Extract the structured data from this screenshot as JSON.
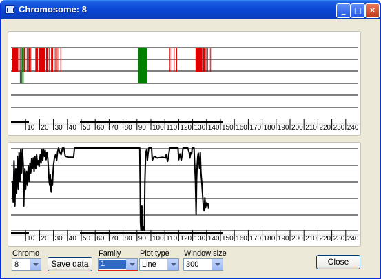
{
  "window": {
    "title": "Chromosome: 8"
  },
  "x_ticks": [
    "10",
    "20",
    "30",
    "40",
    "50",
    "60",
    "70",
    "80",
    "90",
    "100",
    "110",
    "120",
    "130",
    "140",
    "150",
    "160",
    "170",
    "180",
    "190",
    "200",
    "210",
    "220",
    "230",
    "240"
  ],
  "colors": {
    "family_a": "#e00000",
    "family_b": "#008000",
    "line": "#000000"
  },
  "top_plot": {
    "track1": [
      {
        "x": [
          0.0,
          4.2
        ],
        "c": "family_a"
      },
      {
        "x": [
          4.5,
          4.9
        ],
        "c": "family_a"
      },
      {
        "x": [
          5.3,
          5.8
        ],
        "c": "family_a"
      },
      {
        "x": [
          6.6,
          7.4
        ],
        "c": "family_b"
      },
      {
        "x": [
          7.6,
          8.2
        ],
        "c": "family_b"
      },
      {
        "x": [
          8.3,
          9.4
        ],
        "c": "family_a"
      },
      {
        "x": [
          10.3,
          10.8
        ],
        "c": "family_a"
      },
      {
        "x": [
          11.5,
          12.6
        ],
        "c": "family_a"
      },
      {
        "x": [
          13.0,
          13.3
        ],
        "c": "family_a"
      },
      {
        "x": [
          16.5,
          17.4
        ],
        "c": "family_a"
      },
      {
        "x": [
          17.8,
          18.2
        ],
        "c": "family_a"
      },
      {
        "x": [
          19.0,
          23.5
        ],
        "c": "family_a"
      },
      {
        "x": [
          24.2,
          25.5
        ],
        "c": "family_a"
      },
      {
        "x": [
          26.1,
          26.6
        ],
        "c": "family_a"
      },
      {
        "x": [
          27.8,
          29.2
        ],
        "c": "family_a"
      },
      {
        "x": [
          30.5,
          31.0
        ],
        "c": "family_a"
      },
      {
        "x": [
          31.9,
          32.4
        ],
        "c": "family_a"
      },
      {
        "x": [
          33.0,
          33.4
        ],
        "c": "family_a"
      },
      {
        "x": [
          34.5,
          35.0
        ],
        "c": "family_a"
      },
      {
        "x": [
          90.3,
          96.8
        ],
        "c": "family_b"
      },
      {
        "x": [
          113.0,
          113.5
        ],
        "c": "family_a"
      },
      {
        "x": [
          114.3,
          114.8
        ],
        "c": "family_a"
      },
      {
        "x": [
          116.0,
          116.5
        ],
        "c": "family_a"
      },
      {
        "x": [
          117.8,
          118.3
        ],
        "c": "family_a"
      },
      {
        "x": [
          131.6,
          136.5
        ],
        "c": "family_a"
      },
      {
        "x": [
          137.0,
          138.2
        ],
        "c": "family_a"
      },
      {
        "x": [
          138.8,
          139.4
        ],
        "c": "family_a"
      },
      {
        "x": [
          140.0,
          140.5
        ],
        "c": "family_a"
      },
      {
        "x": [
          141.2,
          141.6
        ],
        "c": "family_a"
      },
      {
        "x": [
          142.2,
          142.6
        ],
        "c": "family_a"
      }
    ],
    "track2": [
      {
        "x": [
          5.4,
          6.0
        ],
        "c": "family_b"
      },
      {
        "x": [
          6.5,
          7.2
        ],
        "c": "family_b"
      },
      {
        "x": [
          7.6,
          8.0
        ],
        "c": "family_b"
      },
      {
        "x": [
          90.3,
          96.8
        ],
        "c": "family_b"
      }
    ]
  },
  "bottom_plot": {
    "points": [
      [
        0,
        0.6
      ],
      [
        0.6,
        0.35
      ],
      [
        1.2,
        0.85
      ],
      [
        1.8,
        0.3
      ],
      [
        2.4,
        0.75
      ],
      [
        3.0,
        0.45
      ],
      [
        3.6,
        0.9
      ],
      [
        4.2,
        0.5
      ],
      [
        4.8,
        0.95
      ],
      [
        5.4,
        0.6
      ],
      [
        6.0,
        0.98
      ],
      [
        6.6,
        0.7
      ],
      [
        7.2,
        0.99
      ],
      [
        7.8,
        0.8
      ],
      [
        8.2,
        0.3
      ],
      [
        8.5,
        0.55
      ],
      [
        9.0,
        0.75
      ],
      [
        9.5,
        0.5
      ],
      [
        10.2,
        0.72
      ],
      [
        10.8,
        0.55
      ],
      [
        11.4,
        0.78
      ],
      [
        12.0,
        0.6
      ],
      [
        12.6,
        0.82
      ],
      [
        13.2,
        0.7
      ],
      [
        13.8,
        0.87
      ],
      [
        14.4,
        0.75
      ],
      [
        15.0,
        0.88
      ],
      [
        15.6,
        0.72
      ],
      [
        16.2,
        0.9
      ],
      [
        16.8,
        0.75
      ],
      [
        17.4,
        0.92
      ],
      [
        18.0,
        0.8
      ],
      [
        18.6,
        0.85
      ],
      [
        19.2,
        0.78
      ],
      [
        20.0,
        0.92
      ],
      [
        20.6,
        0.82
      ],
      [
        21.2,
        0.98
      ],
      [
        21.8,
        0.85
      ],
      [
        22.4,
        0.99
      ],
      [
        23.0,
        0.9
      ],
      [
        23.6,
        0.97
      ],
      [
        24.2,
        0.86
      ],
      [
        24.8,
        0.95
      ],
      [
        25.4,
        0.88
      ],
      [
        26.0,
        0.72
      ],
      [
        26.4,
        0.6
      ],
      [
        26.8,
        0.55
      ],
      [
        27.2,
        0.68
      ],
      [
        27.6,
        0.5
      ],
      [
        28.0,
        0.47
      ],
      [
        28.4,
        0.62
      ],
      [
        28.8,
        0.55
      ],
      [
        29.2,
        0.7
      ],
      [
        29.6,
        0.8
      ],
      [
        30.2,
        0.88
      ],
      [
        31.0,
        0.92
      ],
      [
        31.8,
        0.85
      ],
      [
        32.5,
        0.96
      ],
      [
        33.2,
        1.0
      ],
      [
        34.0,
        0.95
      ],
      [
        35.0,
        0.92
      ],
      [
        36.0,
        1.0
      ],
      [
        37.0,
        1.0
      ],
      [
        38.0,
        0.9
      ],
      [
        40.0,
        0.89
      ],
      [
        44.0,
        0.89
      ],
      [
        44.6,
        1.0
      ],
      [
        60,
        1.0
      ],
      [
        90,
        1.0
      ],
      [
        91.5,
        1.0
      ],
      [
        91.8,
        0.55
      ],
      [
        92.0,
        0.1
      ],
      [
        92.4,
        0.0
      ],
      [
        93.0,
        0.3
      ],
      [
        93.4,
        0.0
      ],
      [
        94.0,
        0.05
      ],
      [
        94.8,
        0.0
      ],
      [
        95.2,
        0.6
      ],
      [
        95.8,
        0.95
      ],
      [
        96.5,
        0.98
      ],
      [
        97.0,
        0.85
      ],
      [
        97.4,
        0.92
      ],
      [
        98.0,
        1.0
      ],
      [
        100,
        1.0
      ],
      [
        100.5,
        0.85
      ],
      [
        101.2,
        0.88
      ],
      [
        102,
        0.9
      ],
      [
        104,
        0.88
      ],
      [
        108,
        0.89
      ],
      [
        110,
        0.88
      ],
      [
        110.5,
        0.92
      ],
      [
        111.5,
        0.84
      ],
      [
        112,
        0.88
      ],
      [
        113,
        1.0
      ],
      [
        119,
        1.0
      ],
      [
        119.5,
        0.86
      ],
      [
        120.4,
        0.93
      ],
      [
        121.3,
        0.85
      ],
      [
        122.0,
        0.92
      ],
      [
        122.6,
        1.0
      ],
      [
        126.0,
        1.0
      ],
      [
        127.0,
        0.95
      ],
      [
        127.5,
        0.88
      ],
      [
        128.2,
        0.95
      ],
      [
        128.8,
        0.93
      ],
      [
        129.2,
        1.0
      ],
      [
        130.5,
        1.0
      ],
      [
        131.0,
        0.8
      ],
      [
        131.5,
        0.6
      ],
      [
        132.0,
        0.2
      ],
      [
        132.4,
        0.62
      ],
      [
        132.8,
        0.8
      ],
      [
        133.2,
        0.9
      ],
      [
        133.6,
        0.94
      ],
      [
        134.0,
        0.84
      ],
      [
        134.5,
        0.75
      ],
      [
        135.0,
        0.95
      ],
      [
        135.5,
        0.7
      ],
      [
        136.0,
        0.6
      ],
      [
        136.6,
        0.45
      ],
      [
        137.2,
        0.3
      ],
      [
        137.8,
        0.24
      ],
      [
        138.3,
        0.4
      ],
      [
        138.8,
        0.28
      ],
      [
        139.3,
        0.34
      ],
      [
        139.8,
        0.31
      ],
      [
        140.5,
        0.33
      ],
      [
        141.0,
        0.27
      ]
    ]
  },
  "controls": {
    "chromo_label": "Chromo",
    "chromo_value": "8",
    "save_label": "Save data",
    "family_label": "Family",
    "family_value": "1",
    "plot_type_label": "Plot type",
    "plot_type_value": "Line",
    "window_size_label": "Window size",
    "window_size_value": "300",
    "close_label": "Close"
  }
}
